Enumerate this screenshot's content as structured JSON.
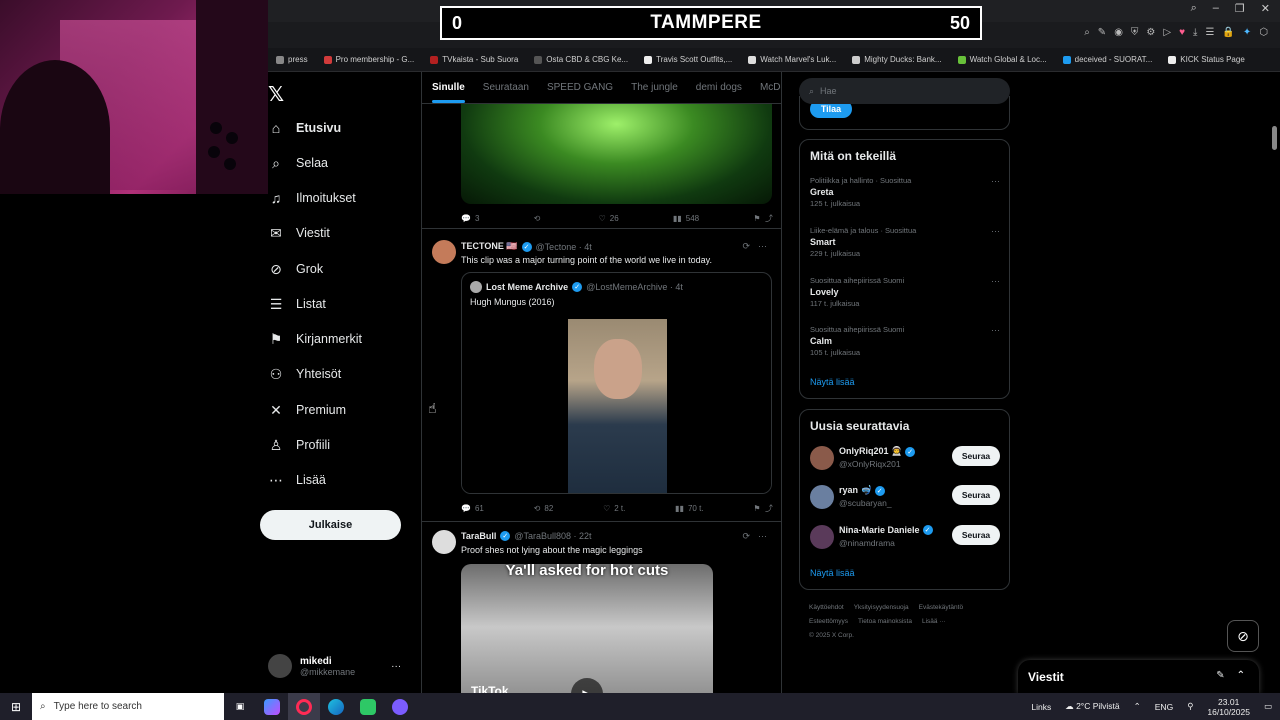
{
  "scoreboard": {
    "home_score": "0",
    "team": "TAMMPERE",
    "away_score": "50"
  },
  "bookmarks": [
    {
      "label": "press",
      "color": "#888888"
    },
    {
      "label": "Pro membership - G...",
      "color": "#d13b3b"
    },
    {
      "label": "TVkaista - Sub Suora",
      "color": "#b32020"
    },
    {
      "label": "Osta CBD & CBG Ke...",
      "color": "#555555"
    },
    {
      "label": "Travis Scott Outfits,...",
      "color": "#eeeeee"
    },
    {
      "label": "Watch Marvel's Luk...",
      "color": "#dddddd"
    },
    {
      "label": "Mighty Ducks: Bank...",
      "color": "#cccccc"
    },
    {
      "label": "Watch Global & Loc...",
      "color": "#68c13a"
    },
    {
      "label": "deceived - SUORAT...",
      "color": "#1d9bf0"
    },
    {
      "label": "KICK Status Page",
      "color": "#eeeeee"
    }
  ],
  "sidebar": {
    "items": [
      {
        "label": "Etusivu",
        "icon": "home-icon",
        "glyph": "⌂"
      },
      {
        "label": "Selaa",
        "icon": "search-icon",
        "glyph": "⌕"
      },
      {
        "label": "Ilmoitukset",
        "icon": "bell-icon",
        "glyph": "♫"
      },
      {
        "label": "Viestit",
        "icon": "mail-icon",
        "glyph": "✉"
      },
      {
        "label": "Grok",
        "icon": "grok-icon",
        "glyph": "⊘"
      },
      {
        "label": "Listat",
        "icon": "list-icon",
        "glyph": "☰"
      },
      {
        "label": "Kirjanmerkit",
        "icon": "bookmark-icon",
        "glyph": "⚑"
      },
      {
        "label": "Yhteisöt",
        "icon": "communities-icon",
        "glyph": "⚇"
      },
      {
        "label": "Premium",
        "icon": "x-premium-icon",
        "glyph": "✕"
      },
      {
        "label": "Profiili",
        "icon": "profile-icon",
        "glyph": "♙"
      },
      {
        "label": "Lisää",
        "icon": "more-circle-icon",
        "glyph": "⋯"
      }
    ],
    "post_button": "Julkaise",
    "account": {
      "name": "mikedi",
      "handle": "@mikkemane"
    }
  },
  "feed": {
    "tabs": [
      "Sinulle",
      "Seurataan",
      "SPEED GANG",
      "The jungle",
      "demi dogs",
      "McDonal"
    ],
    "post1_actions": {
      "replies": "3",
      "retweets": "",
      "likes": "26",
      "views": "548"
    },
    "post2": {
      "name": "TECTONE 🇺🇸",
      "handle": "@Tectone · 4t",
      "text": "This clip was a major turning point of the world we live in today.",
      "quote": {
        "name": "Lost Meme Archive",
        "handle": "@LostMemeArchive · 4t",
        "text": "Hugh Mungus (2016)"
      },
      "actions": {
        "replies": "61",
        "retweets": "82",
        "likes": "2 t.",
        "views": "70 t."
      }
    },
    "post3": {
      "name": "TaraBull",
      "handle": "@TaraBull808 · 22t",
      "text": "Proof shes not lying about the magic leggings",
      "media_caption": "Ya'll asked for hot cuts",
      "media_logo": "TikTok"
    }
  },
  "right": {
    "search_placeholder": "Hae",
    "subscribe_label": "Tilaa",
    "trends_title": "Mitä on tekeillä",
    "trends": [
      {
        "context": "Politiikka ja hallinto · Suosittua",
        "title": "Greta",
        "count": "125 t. julkaisua"
      },
      {
        "context": "Liike-elämä ja talous · Suosittua",
        "title": "Smart",
        "count": "229 t. julkaisua"
      },
      {
        "context": "Suosittua aihepiirissä Suomi",
        "title": "Lovely",
        "count": "117 t. julkaisua"
      },
      {
        "context": "Suosittua aihepiirissä Suomi",
        "title": "Calm",
        "count": "105 t. julkaisua"
      }
    ],
    "show_more": "Näytä lisää",
    "who_to_follow_title": "Uusia seurattavia",
    "follow": [
      {
        "name": "OnlyRiq201 👨‍🚀",
        "handle": "@xOnlyRiqx201",
        "button": "Seuraa",
        "color": "#8a5a4a"
      },
      {
        "name": "ryan 🤿",
        "handle": "@scubaryan_",
        "button": "Seuraa",
        "color": "#6a7fa0"
      },
      {
        "name": "Nina-Marie Daniele",
        "handle": "@ninamdrama",
        "button": "Seuraa",
        "color": "#5a3a5a"
      }
    ],
    "show_more_2": "Näytä lisää",
    "footer": [
      "Käyttöehdot",
      "Yksityisyydensuoja",
      "Evästekäytäntö",
      "Esteettömyys",
      "Tietoa mainoksista",
      "Lisää ···",
      "© 2025 X Corp."
    ],
    "messages_drawer": "Viestit"
  },
  "taskbar": {
    "search": "Type here to search",
    "links": "Links",
    "weather": "2°C Pilvistä",
    "lang": "ENG",
    "time": "23.01",
    "date": "16/10/2025"
  }
}
